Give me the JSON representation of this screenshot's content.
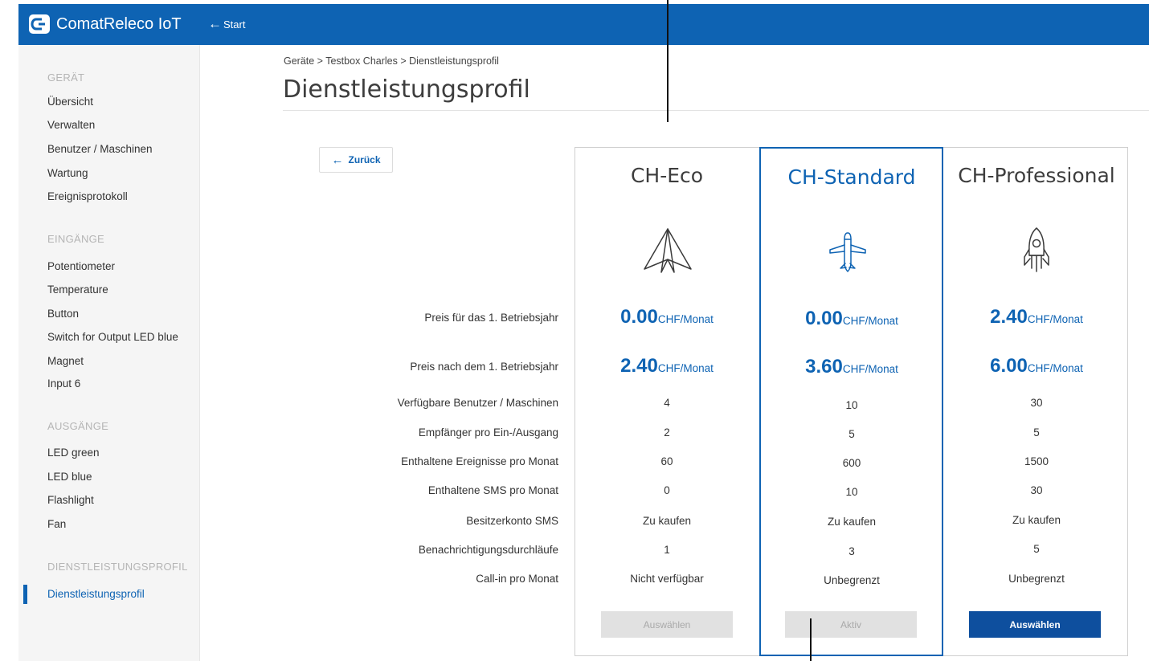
{
  "app": {
    "brand": "ComatReleco IoT",
    "start_label": "Start"
  },
  "sidebar": {
    "sections": [
      {
        "heading": "GERÄT",
        "items": [
          "Übersicht",
          "Verwalten",
          "Benutzer / Maschinen",
          "Wartung",
          "Ereignisprotokoll"
        ]
      },
      {
        "heading": "EINGÄNGE",
        "items": [
          "Potentiometer",
          "Temperature",
          "Button",
          "Switch for Output LED blue",
          "Magnet",
          "Input 6"
        ]
      },
      {
        "heading": "AUSGÄNGE",
        "items": [
          "LED green",
          "LED blue",
          "Flashlight",
          "Fan"
        ]
      },
      {
        "heading": "DIENSTLEISTUNGSPROFIL",
        "items": [
          "Dienstleistungsprofil"
        ]
      }
    ],
    "active_item": "Dienstleistungsprofil"
  },
  "main": {
    "breadcrumb": "Geräte > Testbox Charles > Dienstleistungsprofil",
    "title": "Dienstleistungsprofil",
    "back_label": "Zurück"
  },
  "plans": [
    {
      "name": "CH-Eco",
      "icon": "paper-plane-icon",
      "price_first_year": "0.00",
      "price_after": "2.40",
      "values": [
        "4",
        "2",
        "60",
        "0",
        "Zu kaufen",
        "1",
        "Nicht verfügbar"
      ],
      "button": "Auswählen",
      "button_state": "disabled"
    },
    {
      "name": "CH-Standard",
      "icon": "airplane-icon",
      "price_first_year": "0.00",
      "price_after": "3.60",
      "values": [
        "10",
        "5",
        "600",
        "10",
        "Zu kaufen",
        "3",
        "Unbegrenzt"
      ],
      "button": "Aktiv",
      "button_state": "active"
    },
    {
      "name": "CH-Professional",
      "icon": "rocket-icon",
      "price_first_year": "2.40",
      "price_after": "6.00",
      "values": [
        "30",
        "5",
        "1500",
        "30",
        "Zu kaufen",
        "5",
        "Unbegrenzt"
      ],
      "button": "Auswählen",
      "button_state": "enabled"
    }
  ],
  "price_unit": "CHF/Monat",
  "price_labels": [
    "Preis für das 1. Betriebsjahr",
    "Preis nach dem 1. Betriebsjahr"
  ],
  "feature_labels": [
    "Verfügbare Benutzer / Maschinen",
    "Empfänger pro Ein-/Ausgang",
    "Enthaltene Ereignisse pro Monat",
    "Enthaltene SMS pro Monat",
    "Besitzerkonto SMS",
    "Benachrichtigungsdurchläufe",
    "Call-in pro Monat"
  ],
  "colors": {
    "brand": "#0e63b3",
    "button_primary": "#0e4f9e",
    "button_disabled": "#e1e1e1",
    "sidebar_bg": "#f5f5f5"
  }
}
